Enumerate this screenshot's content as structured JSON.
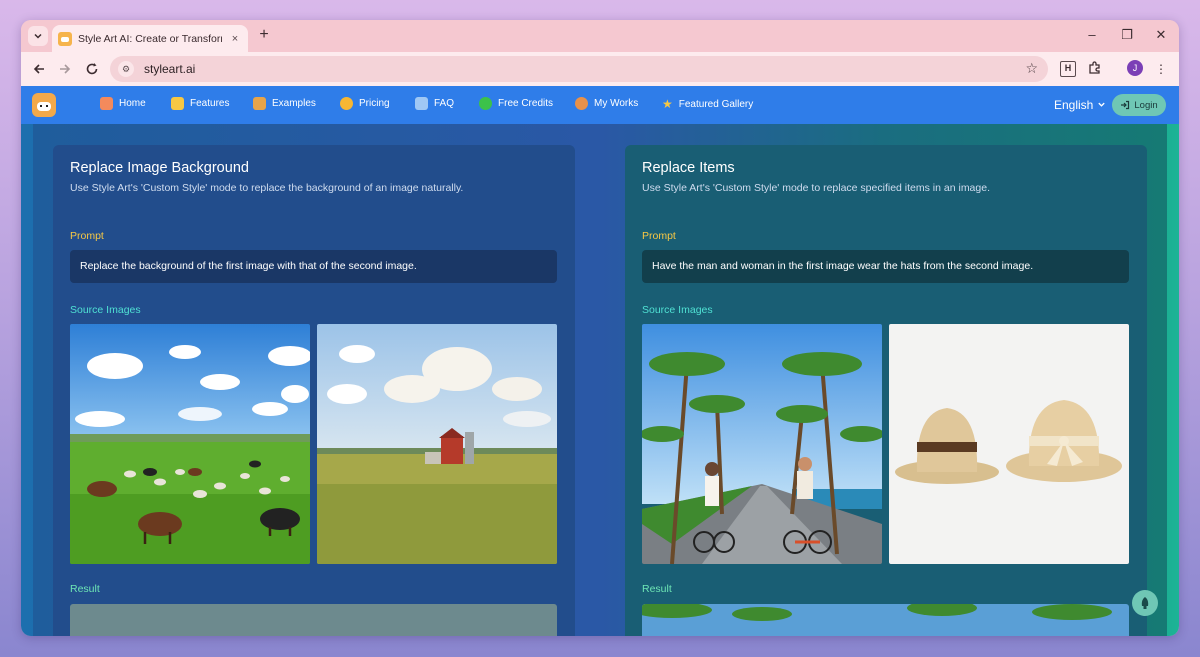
{
  "browser": {
    "tab_title": "Style Art AI: Create or Transform",
    "tab_close": "×",
    "new_tab": "+",
    "url": "styleart.ai",
    "window_controls": {
      "minimize": "–",
      "restore": "❐",
      "close": "✕"
    },
    "profile_initial": "J",
    "extension_h": "H"
  },
  "nav": {
    "items": [
      {
        "label": "Home",
        "icon": "house-icon",
        "color": "#f48a5c"
      },
      {
        "label": "Features",
        "icon": "grid-icon",
        "color": "#f7c844"
      },
      {
        "label": "Examples",
        "icon": "signpost-icon",
        "color": "#e6a44a"
      },
      {
        "label": "Pricing",
        "icon": "coin-icon",
        "color": "#f7b733"
      },
      {
        "label": "FAQ",
        "icon": "book-icon",
        "color": "#9fc8f5"
      },
      {
        "label": "Free Credits",
        "icon": "free-badge-icon",
        "color": "#3cc24a"
      },
      {
        "label": "My Works",
        "icon": "palette-icon",
        "color": "#e8914a"
      },
      {
        "label": "Featured Gallery",
        "icon": "star-icon",
        "color": "#f7c844"
      }
    ],
    "language": "English",
    "login": "Login"
  },
  "cards": [
    {
      "title": "Replace Image Background",
      "description": "Use Style Art's 'Custom Style' mode to replace the background of an image naturally.",
      "prompt_label": "Prompt",
      "prompt": "Replace the background of the first image with that of the second image.",
      "source_label": "Source Images",
      "result_label": "Result"
    },
    {
      "title": "Replace Items",
      "description": "Use Style Art's 'Custom Style' mode to replace specified items in an image.",
      "prompt_label": "Prompt",
      "prompt": "Have the man and woman in the first image wear the hats from the second image.",
      "source_label": "Source Images",
      "result_label": "Result"
    }
  ]
}
